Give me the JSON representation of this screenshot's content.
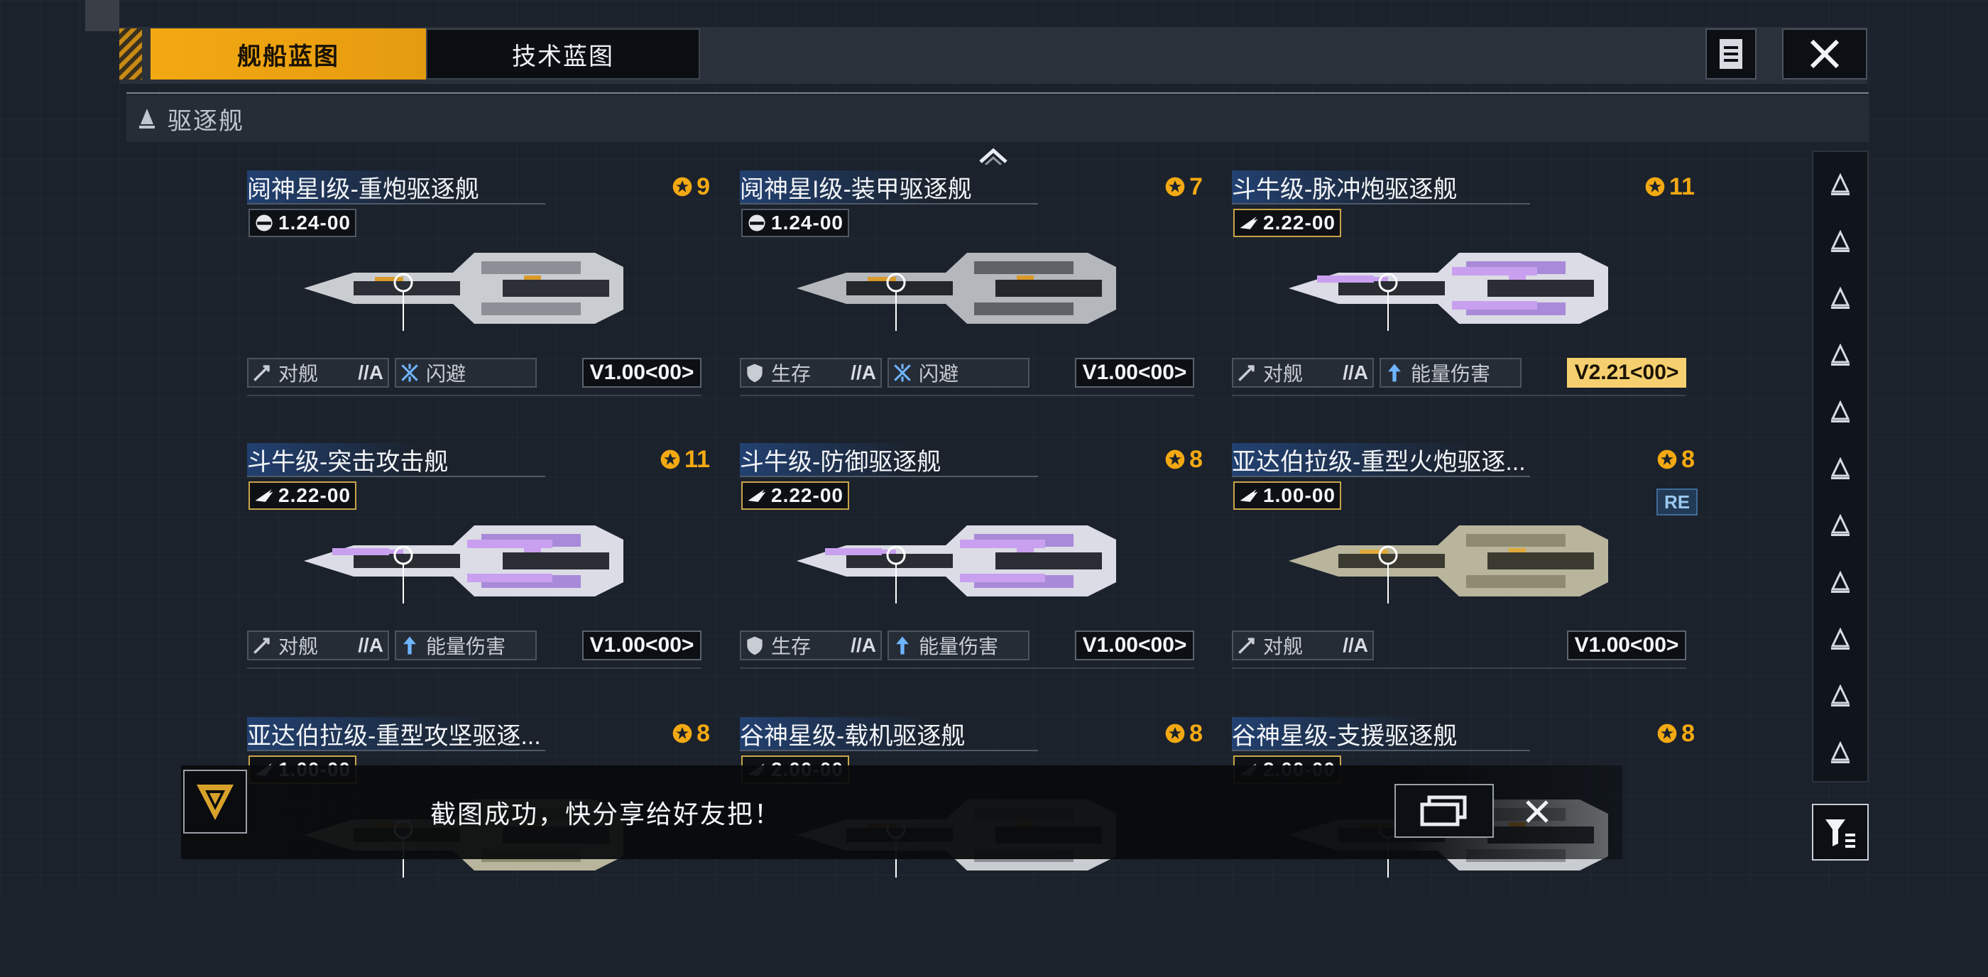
{
  "tabs": [
    {
      "label": "舰船蓝图",
      "active": true
    },
    {
      "label": "技术蓝图",
      "active": false
    }
  ],
  "top_icons": [
    "document-list-icon",
    "close-icon"
  ],
  "category": {
    "label": "驱逐舰",
    "icon": "destroyer-class-icon"
  },
  "cards": [
    {
      "title": "阋神星I级-重炮驱逐舰",
      "stars": "9",
      "version": "1.24-00",
      "version_icon": "helmet-icon",
      "ship_palette": "grey",
      "tag1": {
        "icon": "attack-ship-icon",
        "label": "对舰",
        "grade": "//A"
      },
      "tag2": {
        "icon": "dodge-icon",
        "label": "闪避",
        "grade": ""
      },
      "code": "V1.00<00>",
      "special": false
    },
    {
      "title": "阋神星I级-装甲驱逐舰",
      "stars": "7",
      "version": "1.24-00",
      "version_icon": "helmet-icon",
      "ship_palette": "grey-dark",
      "tag1": {
        "icon": "shield-icon",
        "label": "生存",
        "grade": "//A"
      },
      "tag2": {
        "icon": "dodge-icon",
        "label": "闪避",
        "grade": ""
      },
      "code": "V1.00<00>",
      "special": false
    },
    {
      "title": "斗牛级-脉冲炮驱逐舰",
      "stars": "11",
      "version": "2.22-00",
      "version_icon": "wing-icon",
      "ship_palette": "violet",
      "tag1": {
        "icon": "attack-ship-icon",
        "label": "对舰",
        "grade": "//A"
      },
      "tag2": {
        "icon": "energy-damage-icon",
        "label": "能量伤害",
        "grade": ""
      },
      "code": "V2.21<00>",
      "special": true
    },
    {
      "title": "斗牛级-突击攻击舰",
      "stars": "11",
      "version": "2.22-00",
      "version_icon": "wing-icon",
      "ship_palette": "violet",
      "tag1": {
        "icon": "attack-ship-icon",
        "label": "对舰",
        "grade": "//A"
      },
      "tag2": {
        "icon": "energy-damage-icon",
        "label": "能量伤害",
        "grade": ""
      },
      "code": "V1.00<00>",
      "special": false
    },
    {
      "title": "斗牛级-防御驱逐舰",
      "stars": "8",
      "version": "2.22-00",
      "version_icon": "wing-icon",
      "ship_palette": "violet",
      "tag1": {
        "icon": "shield-icon",
        "label": "生存",
        "grade": "//A"
      },
      "tag2": {
        "icon": "energy-damage-icon",
        "label": "能量伤害",
        "grade": ""
      },
      "code": "V1.00<00>",
      "special": false
    },
    {
      "title": "亚达伯拉级-重型火炮驱逐...",
      "stars": "8",
      "version": "1.00-00",
      "version_icon": "wing-icon",
      "ship_palette": "khaki",
      "badge": "RE",
      "tag1": {
        "icon": "attack-ship-icon",
        "label": "对舰",
        "grade": "//A"
      },
      "tag2": null,
      "code": "V1.00<00>",
      "special": false
    },
    {
      "title": "亚达伯拉级-重型攻坚驱逐...",
      "stars": "8",
      "version": "1.00-00",
      "version_icon": "wing-icon",
      "ship_palette": "khaki"
    },
    {
      "title": "谷神星级-载机驱逐舰",
      "stars": "8",
      "version": "2.00-00",
      "version_icon": "wing-icon",
      "ship_palette": "grey"
    },
    {
      "title": "谷神星级-支援驱逐舰",
      "stars": "8",
      "version": "2.00-00",
      "version_icon": "wing-icon",
      "ship_palette": "grey"
    }
  ],
  "side_rail": [
    "frigate-class-icon",
    "destroyer-type-icon",
    "cruiser-class-icon",
    "battlecruiser-class-icon",
    "destroyer-class-icon",
    "carrier-class-icon",
    "battleship-class-icon",
    "aux-ship-icon",
    "corvette-class-icon",
    "special-ship-icon",
    "outpost-icon"
  ],
  "filter": {
    "icon": "filter-icon"
  },
  "toast": {
    "text": "截图成功，快分享给好友把！",
    "icon": "game-logo-icon",
    "share_icon": "share-screenshot-icon",
    "close_icon": "close-icon"
  },
  "colors": {
    "accent": "#f3a912",
    "special_code": "#f6d070",
    "background": "#1b222c",
    "title_band": "#285aaa"
  }
}
